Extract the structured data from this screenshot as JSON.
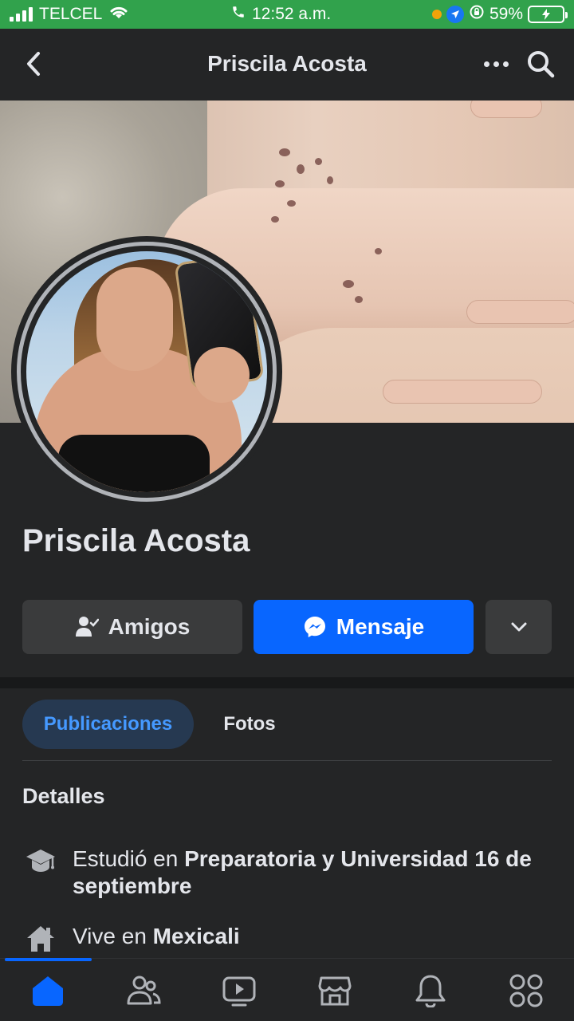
{
  "status_bar": {
    "carrier": "TELCEL",
    "time": "12:52 a.m.",
    "battery": "59%"
  },
  "header": {
    "title": "Priscila Acosta",
    "icons": [
      "back-arrow-icon",
      "more-dots-icon",
      "search-icon"
    ]
  },
  "profile": {
    "name": "Priscila Acosta"
  },
  "actions": {
    "friends_label": "Amigos",
    "message_label": "Mensaje"
  },
  "tabs": [
    {
      "label": "Publicaciones",
      "active": true
    },
    {
      "label": "Fotos",
      "active": false
    }
  ],
  "details": {
    "heading": "Detalles",
    "items": [
      {
        "icon": "graduation-cap-icon",
        "prefix": "Estudió en ",
        "value": "Preparatoria y Universidad 16 de septiembre"
      },
      {
        "icon": "home-icon",
        "prefix": "Vive en ",
        "value": "Mexicali"
      }
    ]
  },
  "bottom_nav": {
    "items": [
      "home-icon",
      "friends-icon",
      "video-icon",
      "marketplace-icon",
      "notifications-icon",
      "menu-icon"
    ],
    "active": "home-icon"
  },
  "colors": {
    "status_bar": "#31a24c",
    "background": "#242526",
    "primary_button": "#0866ff",
    "secondary_button": "#3a3b3c",
    "active_tab_bg": "#263951",
    "active_tab_text": "#4599ff",
    "text": "#e4e6eb"
  }
}
